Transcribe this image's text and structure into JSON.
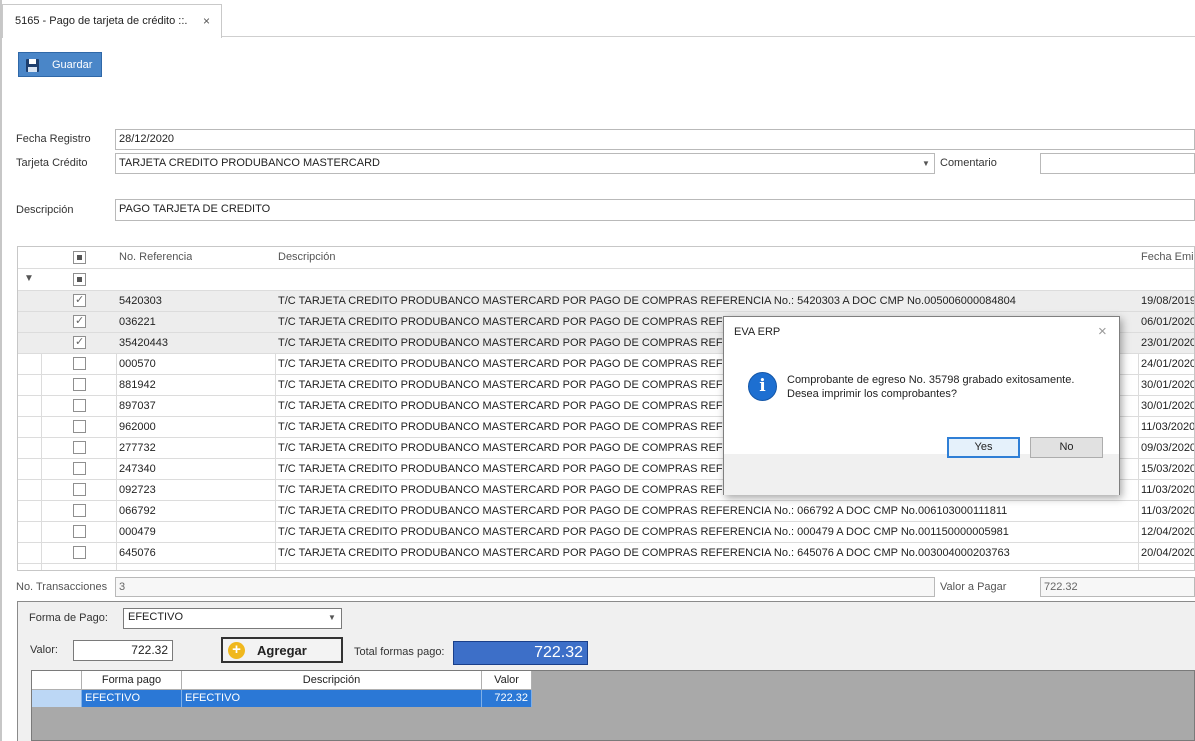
{
  "tab": {
    "title": "5165 - Pago de tarjeta de crédito ::.",
    "close": "×"
  },
  "toolbar": {
    "save_label": "Guardar"
  },
  "form": {
    "fecha_registro_label": "Fecha Registro",
    "fecha_registro_value": "28/12/2020",
    "tarjeta_label": "Tarjeta Crédito",
    "tarjeta_value": "TARJETA CREDITO PRODUBANCO MASTERCARD",
    "comentario_label": "Comentario",
    "comentario_value": "",
    "descripcion_label": "Descripción",
    "descripcion_value": "PAGO TARJETA DE CREDITO"
  },
  "grid": {
    "headers": {
      "referencia": "No. Referencia",
      "descripcion": "Descripción",
      "fecha": "Fecha Emisi"
    },
    "rows": [
      {
        "checked": true,
        "ref": "5420303",
        "desc": "T/C TARJETA CREDITO PRODUBANCO MASTERCARD POR PAGO DE COMPRAS REFERENCIA No.: 5420303 A DOC CMP No.005006000084804",
        "fecha": "19/08/2019"
      },
      {
        "checked": true,
        "ref": "036221",
        "desc": "T/C TARJETA CREDITO PRODUBANCO MASTERCARD POR PAGO DE COMPRAS REFERENCIA",
        "fecha": "06/01/2020"
      },
      {
        "checked": true,
        "ref": "35420443",
        "desc": "T/C TARJETA CREDITO PRODUBANCO MASTERCARD POR PAGO DE COMPRAS REFERENCIA",
        "fecha": "23/01/2020"
      },
      {
        "checked": false,
        "ref": "000570",
        "desc": "T/C TARJETA CREDITO PRODUBANCO MASTERCARD POR PAGO DE COMPRAS REFERENCIA",
        "fecha": "24/01/2020"
      },
      {
        "checked": false,
        "ref": "881942",
        "desc": "T/C TARJETA CREDITO PRODUBANCO MASTERCARD POR PAGO DE COMPRAS REFERENCIA",
        "fecha": "30/01/2020"
      },
      {
        "checked": false,
        "ref": "897037",
        "desc": "T/C TARJETA CREDITO PRODUBANCO MASTERCARD POR PAGO DE COMPRAS REFERENCIA",
        "fecha": "30/01/2020"
      },
      {
        "checked": false,
        "ref": "962000",
        "desc": "T/C TARJETA CREDITO PRODUBANCO MASTERCARD POR PAGO DE COMPRAS REFERENCIA",
        "fecha": "11/03/2020"
      },
      {
        "checked": false,
        "ref": "277732",
        "desc": "T/C TARJETA CREDITO PRODUBANCO MASTERCARD POR PAGO DE COMPRAS REFERENCIA",
        "fecha": "09/03/2020"
      },
      {
        "checked": false,
        "ref": "247340",
        "desc": "T/C TARJETA CREDITO PRODUBANCO MASTERCARD POR PAGO DE COMPRAS REFERENCIA No.: 247340 A DOC CMP No.034018000021272",
        "fecha": "15/03/2020"
      },
      {
        "checked": false,
        "ref": "092723",
        "desc": "T/C TARJETA CREDITO PRODUBANCO MASTERCARD POR PAGO DE COMPRAS REFERENCIA No.: 092723 A DOC CMP No.006103000111813",
        "fecha": "11/03/2020"
      },
      {
        "checked": false,
        "ref": "066792",
        "desc": "T/C TARJETA CREDITO PRODUBANCO MASTERCARD POR PAGO DE COMPRAS REFERENCIA No.: 066792 A DOC CMP No.006103000111811",
        "fecha": "11/03/2020"
      },
      {
        "checked": false,
        "ref": "000479",
        "desc": "T/C TARJETA CREDITO PRODUBANCO MASTERCARD POR PAGO DE COMPRAS REFERENCIA No.: 000479 A DOC CMP No.001150000005981",
        "fecha": "12/04/2020"
      },
      {
        "checked": false,
        "ref": "645076",
        "desc": "T/C TARJETA CREDITO PRODUBANCO MASTERCARD POR PAGO DE COMPRAS REFERENCIA No.: 645076 A DOC CMP No.003004000203763",
        "fecha": "20/04/2020"
      }
    ]
  },
  "summary": {
    "transacciones_label": "No. Transacciones",
    "transacciones_value": "3",
    "valor_pagar_label": "Valor a Pagar",
    "valor_pagar_value": "722.32"
  },
  "payment": {
    "forma_label": "Forma de Pago:",
    "forma_value": "EFECTIVO",
    "valor_label": "Valor:",
    "valor_value": "722.32",
    "add_label": "Agregar",
    "total_label": "Total formas pago:",
    "total_value": "722.32",
    "grid_headers": {
      "forma": "Forma pago",
      "descripcion": "Descripción",
      "valor": "Valor"
    },
    "grid_rows": [
      {
        "forma": "EFECTIVO",
        "descripcion": "EFECTIVO",
        "valor": "722.32"
      }
    ]
  },
  "dialog": {
    "title": "EVA ERP",
    "message_line1": "Comprobante de egreso No. 35798 grabado exitosamente.",
    "message_line2": "Desea imprimir los comprobantes?",
    "yes_label": "Yes",
    "no_label": "No",
    "icon": "info-icon"
  },
  "colors": {
    "accent": "#4a86c8",
    "selection": "#2b78d6",
    "dialog_icon": "#1d6fd1"
  }
}
